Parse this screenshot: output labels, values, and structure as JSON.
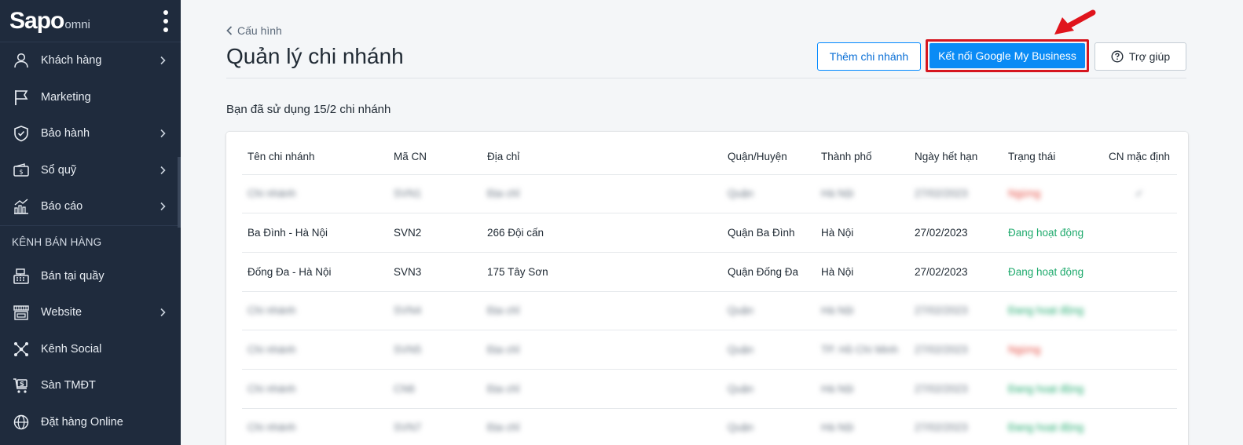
{
  "sidebar": {
    "logo": "Sapo",
    "logo_suffix": "omni",
    "items": [
      {
        "label": "Khách hàng",
        "icon": "user-icon",
        "has_chevron": true
      },
      {
        "label": "Marketing",
        "icon": "flag-icon",
        "has_chevron": false
      },
      {
        "label": "Bảo hành",
        "icon": "shield-icon",
        "has_chevron": true
      },
      {
        "label": "Sổ quỹ",
        "icon": "wallet-icon",
        "has_chevron": true
      },
      {
        "label": "Báo cáo",
        "icon": "chart-icon",
        "has_chevron": true
      }
    ],
    "section_label": "KÊNH BÁN HÀNG",
    "channels": [
      {
        "label": "Bán tại quầy",
        "icon": "cash-register-icon",
        "has_chevron": false
      },
      {
        "label": "Website",
        "icon": "store-icon",
        "has_chevron": true
      },
      {
        "label": "Kênh Social",
        "icon": "social-network-icon",
        "has_chevron": false
      },
      {
        "label": "Sàn TMĐT",
        "icon": "shopping-cart-icon",
        "has_chevron": false
      },
      {
        "label": "Đặt hàng Online",
        "icon": "globe-icon",
        "has_chevron": false
      }
    ]
  },
  "header": {
    "breadcrumb": "Cấu hình",
    "title": "Quản lý chi nhánh",
    "add_branch_label": "Thêm chi nhánh",
    "connect_google_label": "Kết nối Google My Business",
    "help_label": "Trợ giúp"
  },
  "usage_text": "Bạn đã sử dụng 15/2 chi nhánh",
  "table": {
    "columns": [
      "Tên chi nhánh",
      "Mã CN",
      "Địa chỉ",
      "Quận/Huyện",
      "Thành phố",
      "Ngày hết hạn",
      "Trạng thái",
      "CN mặc định"
    ],
    "rows": [
      {
        "name": "Chi nhánh",
        "code": "SVN1",
        "address": "Địa chỉ",
        "district": "Quận",
        "city": "Hà Nội",
        "expiry": "27/02/2023",
        "status": "Ngừng",
        "status_type": "inactive",
        "default": "✓",
        "blurred": true
      },
      {
        "name": "Ba Đình - Hà Nội",
        "code": "SVN2",
        "address": "266 Đội cấn",
        "district": "Quận Ba Đình",
        "city": "Hà Nội",
        "expiry": "27/02/2023",
        "status": "Đang hoạt động",
        "status_type": "active",
        "default": "",
        "blurred": false
      },
      {
        "name": "Đống Đa - Hà Nội",
        "code": "SVN3",
        "address": "175 Tây Sơn",
        "district": "Quận Đống Đa",
        "city": "Hà Nội",
        "expiry": "27/02/2023",
        "status": "Đang hoạt động",
        "status_type": "active",
        "default": "",
        "blurred": false
      },
      {
        "name": "Chi nhánh",
        "code": "SVN4",
        "address": "Địa chỉ",
        "district": "Quận",
        "city": "Hà Nội",
        "expiry": "27/02/2023",
        "status": "Đang hoạt động",
        "status_type": "active",
        "default": "",
        "blurred": true
      },
      {
        "name": "Chi nhánh",
        "code": "SVN5",
        "address": "Địa chỉ",
        "district": "Quận",
        "city": "TP. Hồ Chí Minh",
        "expiry": "27/02/2023",
        "status": "Ngừng",
        "status_type": "inactive",
        "default": "",
        "blurred": true
      },
      {
        "name": "Chi nhánh",
        "code": "CN6",
        "address": "Địa chỉ",
        "district": "Quận",
        "city": "Hà Nội",
        "expiry": "27/02/2023",
        "status": "Đang hoạt động",
        "status_type": "active",
        "default": "",
        "blurred": true
      },
      {
        "name": "Chi nhánh",
        "code": "SVN7",
        "address": "Địa chỉ",
        "district": "Quận",
        "city": "Hà Nội",
        "expiry": "27/02/2023",
        "status": "Đang hoạt động",
        "status_type": "active",
        "default": "",
        "blurred": true
      }
    ]
  },
  "colors": {
    "sidebar_bg": "#1f2b3d",
    "primary": "#0a8bf5",
    "highlight_border": "#d6161f",
    "active_status": "#1faa6d",
    "inactive_status": "#e4493f"
  }
}
